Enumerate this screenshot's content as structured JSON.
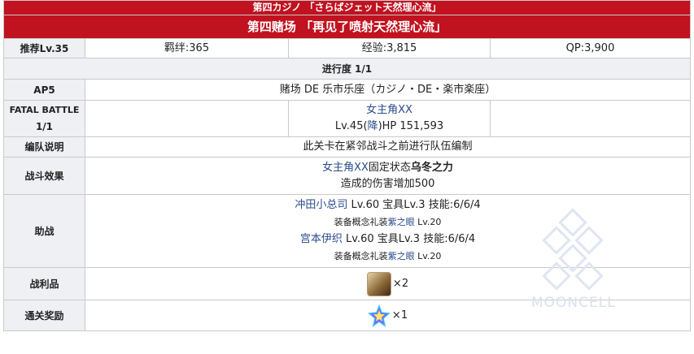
{
  "header": {
    "title_jp": "第四カジノ 「さらばジェット天然理心流」",
    "title_cn": "第四赌场 「再见了喷射天然理心流」"
  },
  "rewards_row": {
    "level": "推荐Lv.35",
    "bond": "羁绊:365",
    "exp": "经验:3,815",
    "qp": "QP:3,900"
  },
  "progress": "进行度 1/1",
  "ap_row": {
    "label": "AP5",
    "location": "赌场 DE 乐市乐座（カジノ・DE・楽市楽座）"
  },
  "battle": {
    "label_line1": "FATAL BATTLE",
    "label_line2": "1/1",
    "enemy_name": "女主角XX",
    "enemy_stats_prefix": "Lv.45(",
    "enemy_class": "降",
    "enemy_stats_suffix": ")HP 151,593"
  },
  "formation": {
    "label": "编队说明",
    "text": "此关卡在紧邻战斗之前进行队伍编制"
  },
  "effect": {
    "label": "战斗效果",
    "servant": "女主角XX",
    "mid": "固定状态",
    "buff": "乌冬之力",
    "line2": "造成的伤害增加500"
  },
  "support": {
    "label": "助战",
    "s1_name": "冲田小总司",
    "s1_stats": " Lv.60 宝具Lv.3 技能:6/6/4",
    "s1_ce_prefix": "装备概念礼装",
    "s1_ce": "紫之眼",
    "s1_ce_lv": " Lv.20",
    "s2_name": "宫本伊织",
    "s2_stats": " Lv.60 宝具Lv.3 技能:6/6/4",
    "s2_ce_prefix": "装备概念礼装",
    "s2_ce": "紫之眼",
    "s2_ce_lv": " Lv.20"
  },
  "drops": {
    "label": "战利品",
    "count": "×2",
    "icon": "material-item-icon"
  },
  "clear_reward": {
    "label": "通关奖励",
    "count": "×1",
    "icon": "saint-quartz-icon"
  },
  "watermark": "MOONCELL",
  "colors": {
    "header_bg": "#c1121f",
    "label_bg": "#eef0f3",
    "link": "#2a4b8d",
    "border": "#c9c9c9"
  }
}
